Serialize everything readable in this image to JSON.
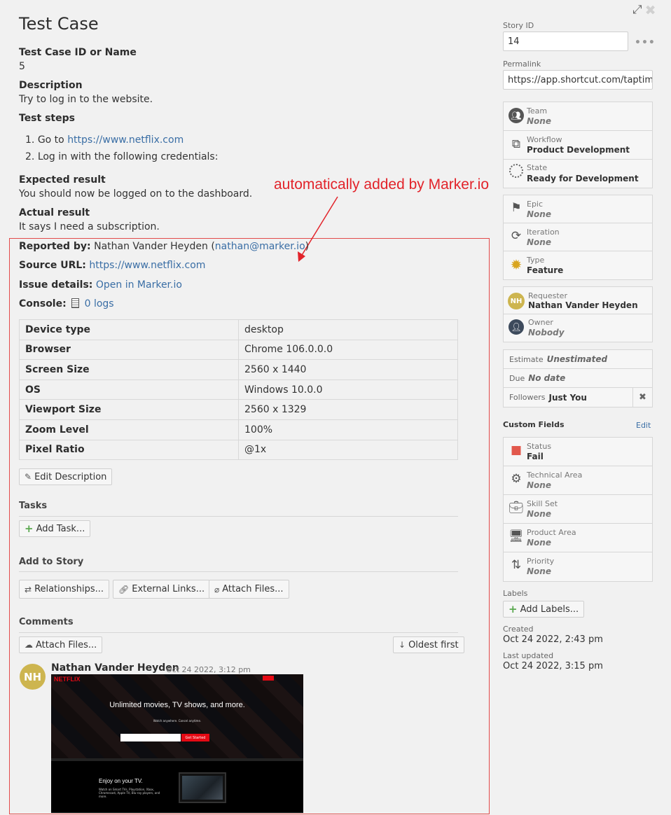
{
  "title": "Test Case",
  "fields": {
    "test_case_id_label": "Test Case ID or Name",
    "test_case_id_value": "5",
    "description_label": "Description",
    "description_value": "Try to log in to the website.",
    "test_steps_label": "Test steps",
    "step1_prefix": "Go to ",
    "step1_link": "https://www.netflix.com",
    "step2": "Log in with the following credentials:",
    "expected_label": "Expected result",
    "expected_value": "You should now be logged on to the dashboard.",
    "actual_label": "Actual result",
    "actual_value": "It says I need a subscription."
  },
  "annotation": "automatically added by Marker.io",
  "report": {
    "reported_by_label": "Reported by:",
    "reporter_name": "Nathan Vander Heyden (",
    "reporter_email": "nathan@marker.io",
    "reporter_close": ")",
    "source_url_label": "Source URL:",
    "source_url": "https://www.netflix.com",
    "issue_details_label": "Issue details:",
    "issue_details_link": "Open in Marker.io",
    "console_label": "Console:",
    "console_logs": "0 logs"
  },
  "device_table": [
    {
      "key": "Device type",
      "value": "desktop"
    },
    {
      "key": "Browser",
      "value": "Chrome 106.0.0.0"
    },
    {
      "key": "Screen Size",
      "value": "2560 x 1440"
    },
    {
      "key": "OS",
      "value": "Windows 10.0.0"
    },
    {
      "key": "Viewport Size",
      "value": "2560 x 1329"
    },
    {
      "key": "Zoom Level",
      "value": "100%"
    },
    {
      "key": "Pixel Ratio",
      "value": "@1x"
    }
  ],
  "buttons": {
    "edit_description": "Edit Description",
    "add_task": "Add Task...",
    "relationships": "Relationships...",
    "external_links": "External Links...",
    "attach_files": "Attach Files...",
    "comment_attach_files": "Attach Files...",
    "oldest_first": "Oldest first"
  },
  "sections": {
    "tasks": "Tasks",
    "add_to_story": "Add to Story",
    "comments": "Comments"
  },
  "comment": {
    "avatar_initials": "NH",
    "author": "Nathan Vander Heyden",
    "date": "Oct 24 2022, 3:12 pm",
    "screenshot": {
      "logo": "NETFLIX",
      "headline": "Unlimited movies, TV shows, and more.",
      "sub": "Watch anywhere. Cancel anytime.",
      "cta": "Get Started",
      "tv_heading": "Enjoy on your TV.",
      "tv_sub": "Watch on Smart TVs, Playstation, Xbox, Chromecast, Apple TV, Blu-ray players, and more."
    }
  },
  "sidebar": {
    "story_id_label": "Story ID",
    "story_id_value": "14",
    "permalink_label": "Permalink",
    "permalink_value": "https://app.shortcut.com/taptim",
    "team_label": "Team",
    "team_value": "None",
    "workflow_label": "Workflow",
    "workflow_value": "Product Development",
    "state_label": "State",
    "state_value": "Ready for Development",
    "epic_label": "Epic",
    "epic_value": "None",
    "iteration_label": "Iteration",
    "iteration_value": "None",
    "type_label": "Type",
    "type_value": "Feature",
    "requester_label": "Requester",
    "requester_value": "Nathan Vander Heyden",
    "requester_initials": "NH",
    "owner_label": "Owner",
    "owner_value": "Nobody",
    "estimate_label": "Estimate",
    "estimate_value": "Unestimated",
    "due_label": "Due",
    "due_value": "No date",
    "followers_label": "Followers",
    "followers_value": "Just You",
    "custom_fields_title": "Custom Fields",
    "custom_fields_edit": "Edit",
    "status_label": "Status",
    "status_value": "Fail",
    "technical_area_label": "Technical Area",
    "technical_area_value": "None",
    "skill_set_label": "Skill Set",
    "skill_set_value": "None",
    "product_area_label": "Product Area",
    "product_area_value": "None",
    "priority_label": "Priority",
    "priority_value": "None",
    "labels_label": "Labels",
    "add_labels": "Add Labels...",
    "created_label": "Created",
    "created_value": "Oct 24 2022, 2:43 pm",
    "last_updated_label": "Last updated",
    "last_updated_value": "Oct 24 2022, 3:15 pm"
  },
  "colors": {
    "link": "#3a6ea5",
    "annotation_red": "#e2232a",
    "avatar": "#cdb54f",
    "status_fail": "#e2584c",
    "type_feature": "#d9a51f"
  }
}
